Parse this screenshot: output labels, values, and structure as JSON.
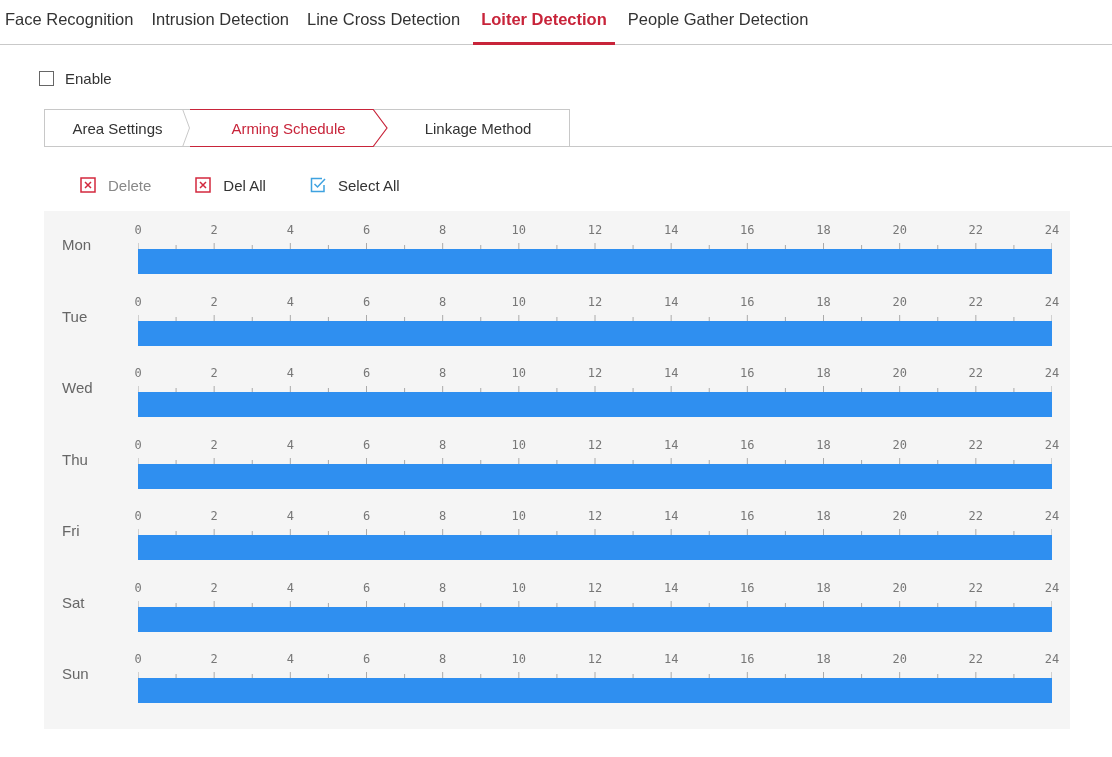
{
  "tabs": [
    {
      "label": "Face Recognition",
      "selected": false
    },
    {
      "label": "Intrusion Detection",
      "selected": false
    },
    {
      "label": "Line Cross Detection",
      "selected": false
    },
    {
      "label": "Loiter Detection",
      "selected": true
    },
    {
      "label": "People Gather Detection",
      "selected": false
    }
  ],
  "enable": {
    "label": "Enable",
    "checked": false
  },
  "steps": [
    {
      "label": "Area Settings",
      "selected": false
    },
    {
      "label": "Arming Schedule",
      "selected": true
    },
    {
      "label": "Linkage Method",
      "selected": false
    }
  ],
  "toolbar": [
    {
      "kind": "delete",
      "label": "Delete",
      "disabled": true
    },
    {
      "kind": "delete",
      "label": "Del All",
      "disabled": false
    },
    {
      "kind": "select",
      "label": "Select All",
      "disabled": false
    }
  ],
  "days": [
    {
      "label": "Mon",
      "ticks": [
        "0",
        "2",
        "4",
        "6",
        "8",
        "10",
        "12",
        "14",
        "16",
        "18",
        "20",
        "22",
        "24"
      ],
      "level": 1
    },
    {
      "label": "Tue",
      "ticks": [
        "0",
        "2",
        "4",
        "6",
        "8",
        "10",
        "12",
        "14",
        "16",
        "18",
        "20",
        "22",
        "24"
      ],
      "level": 1
    },
    {
      "label": "Wed",
      "ticks": [
        "0",
        "2",
        "4",
        "6",
        "8",
        "10",
        "12",
        "14",
        "16",
        "18",
        "20",
        "22",
        "24"
      ],
      "level": 1
    },
    {
      "label": "Thu",
      "ticks": [
        "0",
        "2",
        "4",
        "6",
        "8",
        "10",
        "12",
        "14",
        "16",
        "18",
        "20",
        "22",
        "24"
      ],
      "level": 1
    },
    {
      "label": "Fri",
      "ticks": [
        "0",
        "2",
        "4",
        "6",
        "8",
        "10",
        "12",
        "14",
        "16",
        "18",
        "20",
        "22",
        "24"
      ],
      "level": 1
    },
    {
      "label": "Sat",
      "ticks": [
        "0",
        "2",
        "4",
        "6",
        "8",
        "10",
        "12",
        "14",
        "16",
        "18",
        "20",
        "22",
        "24"
      ],
      "level": 1
    },
    {
      "label": "Sun",
      "ticks": [
        "0",
        "2",
        "4",
        "6",
        "8",
        "10",
        "12",
        "14",
        "16",
        "18",
        "20",
        "22",
        "24"
      ],
      "level": 1
    }
  ]
}
